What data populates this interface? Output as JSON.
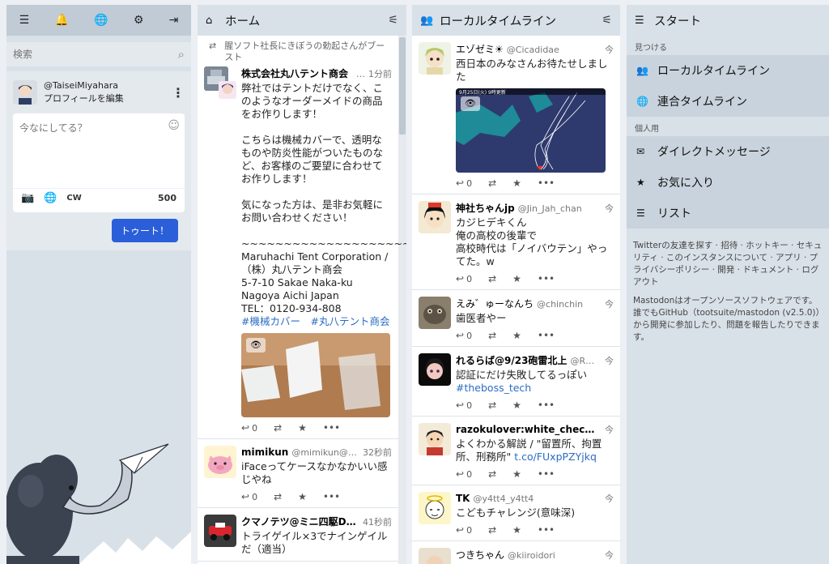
{
  "drawer": {
    "nav_icons": [
      "menu-icon",
      "bell-icon",
      "globe-icon",
      "gear-icon",
      "logout-icon"
    ],
    "nav_glyphs": [
      "☰",
      "🔔",
      "🌐",
      "⚙",
      "⇥"
    ],
    "search_placeholder": "検索",
    "profile": {
      "handle": "@TaiseiMiyahara",
      "edit_label": "プロフィールを編集"
    },
    "compose": {
      "placeholder": "今なにしてる？",
      "cw_label": "CW",
      "char_count": "500",
      "toot_label": "トゥート！"
    }
  },
  "home": {
    "title": "ホーム",
    "boost_note": "腥ソフト社長にきぼうの勅起さんがブースト",
    "statuses": [
      {
        "display_name": "株式会社丸八テント商会",
        "acct": "…",
        "time": "1分前",
        "content_1": "弊社ではテントだけでなく、このようなオーダーメイドの商品をお作りします！\n\nこちらは機械カバーで、透明なものや防炎性能がついたものなど、お客様のご要望に合わせてお作りします！\n\n気になった方は、是非お気軽にお問い合わせください！\n\n~~~~~~~~~~~~~~~~~~~~~~\nMaruhachi Tent Corporation /（株）丸八テント商会\n5-7-10 Sakae Naka-ku Nagoya Aichi Japan\nTEL：0120-934-808",
        "tags": "#機械カバー　#丸八テント商会",
        "reply_count": "0"
      },
      {
        "display_name": "mimikun",
        "acct": "@mimikun@…",
        "time": "32秒前",
        "content": "iFaceってケースなかなかいい感じやね",
        "reply_count": "0"
      },
      {
        "display_name": "クマノテツ@ミニ四駆DO…",
        "acct": "",
        "time": "41秒前",
        "content": "トライゲイル×3でナインゲイルだ（適当）",
        "reply_count": "0"
      }
    ]
  },
  "local": {
    "title": "ローカルタイムライン",
    "statuses": [
      {
        "display_name": "エゾゼミ☀",
        "acct": "@Cicadidae",
        "time": "今",
        "content": "西日本のみなさんお待たせしました",
        "reply_count": "0",
        "map_caption": "9月25日(火) 9時更新"
      },
      {
        "display_name": "神社ちゃんjp",
        "acct": "@Jin_Jah_chan",
        "time": "今",
        "content": "カジヒデキくん\n俺の高校の後輩で\n高校時代は「ノイバウテン」やってた。w",
        "reply_count": "0"
      },
      {
        "display_name": "えみ゛ゅーなんち",
        "acct": "@chinchin",
        "time": "今",
        "content": "歯医者やー",
        "reply_count": "0"
      },
      {
        "display_name": "れるらば@9/23砲雷北上",
        "acct": "@R…",
        "time": "今",
        "content": "認証にだけ失敗してるっぽい",
        "tag": "#theboss_tech",
        "reply_count": "0"
      },
      {
        "display_name": "razokulover:white_check_ma…",
        "acct": "",
        "time": "今",
        "content": "よくわかる解説 / \"留置所、拘置所、刑務所\"",
        "link": "t.co/FUxpPZYjkq",
        "reply_count": "0"
      },
      {
        "display_name": "TK",
        "acct": "@y4tt4_y4tt4",
        "time": "今",
        "content": "こどもチャレンジ(意味深)",
        "reply_count": "0"
      },
      {
        "display_name": "つきちゃん",
        "acct": "@kiiroidori",
        "time": "今",
        "content": "",
        "reply_count": ""
      }
    ]
  },
  "start": {
    "title": "スタート",
    "discover_label": "見つける",
    "local_label": "ローカルタイムライン",
    "federated_label": "連合タイムライン",
    "personal_label": "個人用",
    "dm_label": "ダイレクトメッセージ",
    "fav_label": "お気に入り",
    "lists_label": "リスト",
    "footer_links": "Twitterの友達を探す · 招待 · ホットキー · セキュリティ · このインスタンスについて · アプリ · プライバシーポリシー · 開発 · ドキュメント · ログアウト",
    "footer_about": "Mastodonはオープンソースソフトウェアです。誰でもGitHub（tootsuite/mastodon (v2.5.0)）から開発に参加したり、問題を報告したりできます。"
  },
  "colors": {
    "accent": "#2b5fd9",
    "column_header": "#d9e1e8",
    "nav_item": "#c9d3dd",
    "link": "#2b6cc4"
  }
}
